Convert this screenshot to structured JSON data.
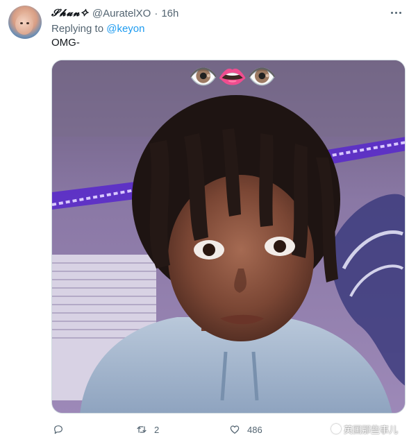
{
  "tweet": {
    "display_name": "𝓢𝓱𝓾𝓷✧",
    "handle": "@AuratelXO",
    "separator": "·",
    "time": "16h",
    "replying_prefix": "Replying to",
    "replying_to": "@keyon",
    "text": "OMG-",
    "media": {
      "filter_emoji": "👁️👄👁️"
    }
  },
  "actions": {
    "reply_icon": "reply-icon",
    "retweet_icon": "retweet-icon",
    "retweet_count": "2",
    "like_icon": "heart-icon",
    "like_count": "486"
  },
  "watermark": {
    "icon": "wechat-icon",
    "text": "英国那些事儿"
  },
  "colors": {
    "link": "#1d9bf0",
    "secondary_text": "#536471",
    "primary_text": "#0f1419",
    "led_purple": "#7b3cff"
  }
}
